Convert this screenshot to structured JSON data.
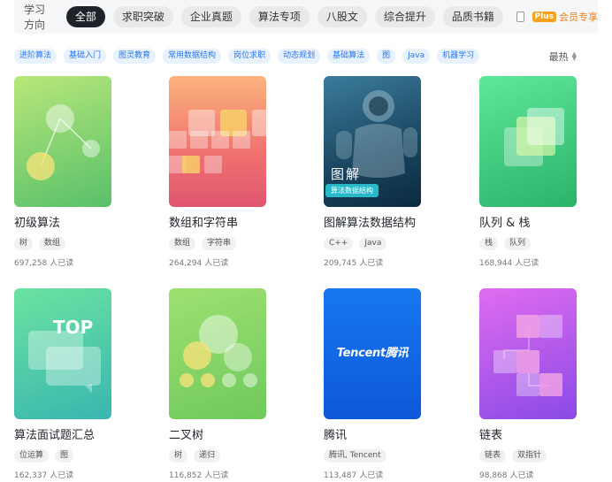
{
  "filter_bar": {
    "direction_label": "学习方向",
    "pills": [
      {
        "label": "全部",
        "active": true
      },
      {
        "label": "求职突破",
        "active": false
      },
      {
        "label": "企业真题",
        "active": false
      },
      {
        "label": "算法专项",
        "active": false
      },
      {
        "label": "八股文",
        "active": false
      },
      {
        "label": "综合提升",
        "active": false
      },
      {
        "label": "品质书籍",
        "active": false
      }
    ],
    "plus_badge": "Plus",
    "vip_label": "会员专享"
  },
  "tags": [
    "进阶算法",
    "基础入门",
    "图灵教育",
    "常用数据结构",
    "岗位求职",
    "动态规划",
    "基础算法",
    "图",
    "Java",
    "机器学习"
  ],
  "sort": {
    "label": "最热"
  },
  "readers_suffix": "人已读",
  "cards": [
    {
      "title": "初级算法",
      "chips": [
        "树",
        "数组"
      ],
      "readers": "697,258"
    },
    {
      "title": "数组和字符串",
      "chips": [
        "数组",
        "字符串"
      ],
      "readers": "264,294"
    },
    {
      "title": "图解算法数据结构",
      "chips": [
        "C++",
        "Java"
      ],
      "readers": "209,745",
      "cover_text": "图解",
      "cover_tag": "算法数据结构"
    },
    {
      "title": "队列 & 栈",
      "chips": [
        "栈",
        "队列"
      ],
      "readers": "168,944"
    },
    {
      "title": "算法面试题汇总",
      "chips": [
        "位运算",
        "图"
      ],
      "readers": "162,337",
      "cover_text": "TOP"
    },
    {
      "title": "二叉树",
      "chips": [
        "树",
        "递归"
      ],
      "readers": "116,852"
    },
    {
      "title": "腾讯",
      "chips": [
        "腾讯, Tencent"
      ],
      "readers": "113,487",
      "cover_text": "Tencent腾讯"
    },
    {
      "title": "链表",
      "chips": [
        "链表",
        "双指针"
      ],
      "readers": "98,868"
    }
  ]
}
